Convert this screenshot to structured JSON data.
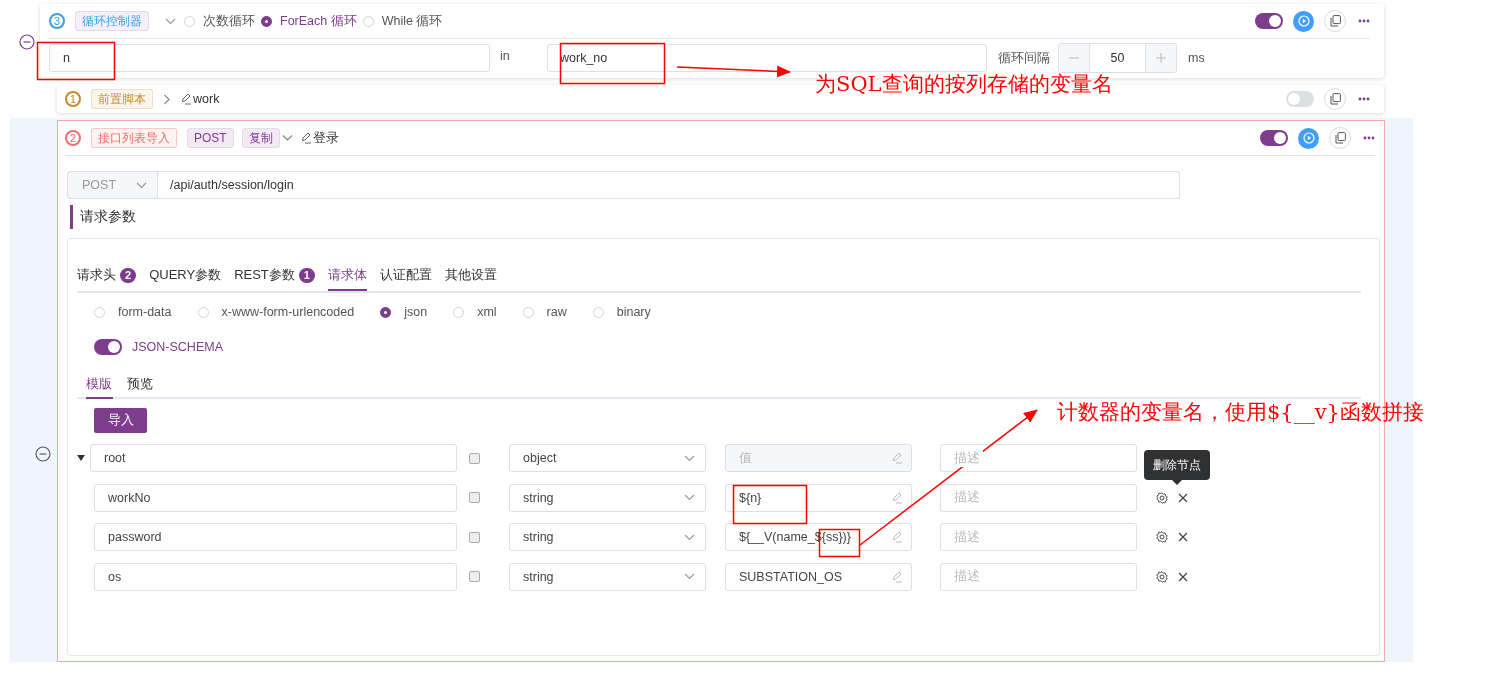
{
  "loop_controller": {
    "number": "3",
    "tag": "循环控制器",
    "enabled": true,
    "loop_types": [
      {
        "label": "次数循环",
        "selected": false
      },
      {
        "label": "ForEach 循环",
        "selected": true
      },
      {
        "label": "While 循环",
        "selected": false
      }
    ],
    "variable_field": {
      "value": "n"
    },
    "in_label": "in",
    "list_field": {
      "value": "work_no"
    },
    "interval_label": "循环间隔",
    "interval_value": "50",
    "interval_unit": "ms"
  },
  "steps": [
    {
      "kind": "script",
      "number": "1",
      "color": "#c58a2c",
      "tag": "前置脚本",
      "name": "work",
      "expanded": false,
      "enabled": false
    },
    {
      "kind": "api",
      "number": "2",
      "color": "#f56c6c",
      "tag": "接口列表导入",
      "method": "POST",
      "copy_tag": "复制",
      "name": "登录",
      "expanded": true,
      "enabled": true
    }
  ],
  "request": {
    "method": "POST",
    "url": "/api/auth/session/login",
    "section_title": "请求参数",
    "tabs": [
      {
        "label": "请求头",
        "badge": "2",
        "selected": false
      },
      {
        "label": "QUERY参数",
        "selected": false
      },
      {
        "label": "REST参数",
        "badge": "1",
        "selected": false
      },
      {
        "label": "请求体",
        "selected": true
      },
      {
        "label": "认证配置",
        "selected": false
      },
      {
        "label": "其他设置",
        "selected": false
      }
    ],
    "body_types": [
      {
        "label": "form-data",
        "selected": false
      },
      {
        "label": "x-www-form-urlencoded",
        "selected": false
      },
      {
        "label": "json",
        "selected": true
      },
      {
        "label": "xml",
        "selected": false
      },
      {
        "label": "raw",
        "selected": false
      },
      {
        "label": "binary",
        "selected": false
      }
    ],
    "json_schema": {
      "label": "JSON-SCHEMA",
      "on": true
    },
    "editor_tabs": [
      {
        "label": "模版",
        "selected": true
      },
      {
        "label": "预览",
        "selected": false
      }
    ],
    "import_button": "导入",
    "schema": {
      "name": "root",
      "required": false,
      "type": "object",
      "value_placeholder": "值",
      "value_disabled": true,
      "description_placeholder": "描述",
      "expanded": true,
      "children": [
        {
          "name": "workNo",
          "required": false,
          "type": "string",
          "value": "${n}",
          "value_disabled": false,
          "description_placeholder": "描述"
        },
        {
          "name": "password",
          "required": false,
          "type": "string",
          "value": "${__V(name_${ss})}",
          "value_disabled": false,
          "description_placeholder": "描述"
        },
        {
          "name": "os",
          "required": false,
          "type": "string",
          "value": "SUBSTATION_OS",
          "value_disabled": false,
          "description_placeholder": "描述"
        }
      ]
    },
    "tooltip": "删除节点"
  },
  "annotations": [
    {
      "text": "为SQL查询的按列存储的变量名"
    },
    {
      "text": "计数器的变量名，使用${__v}函数拼接"
    }
  ]
}
